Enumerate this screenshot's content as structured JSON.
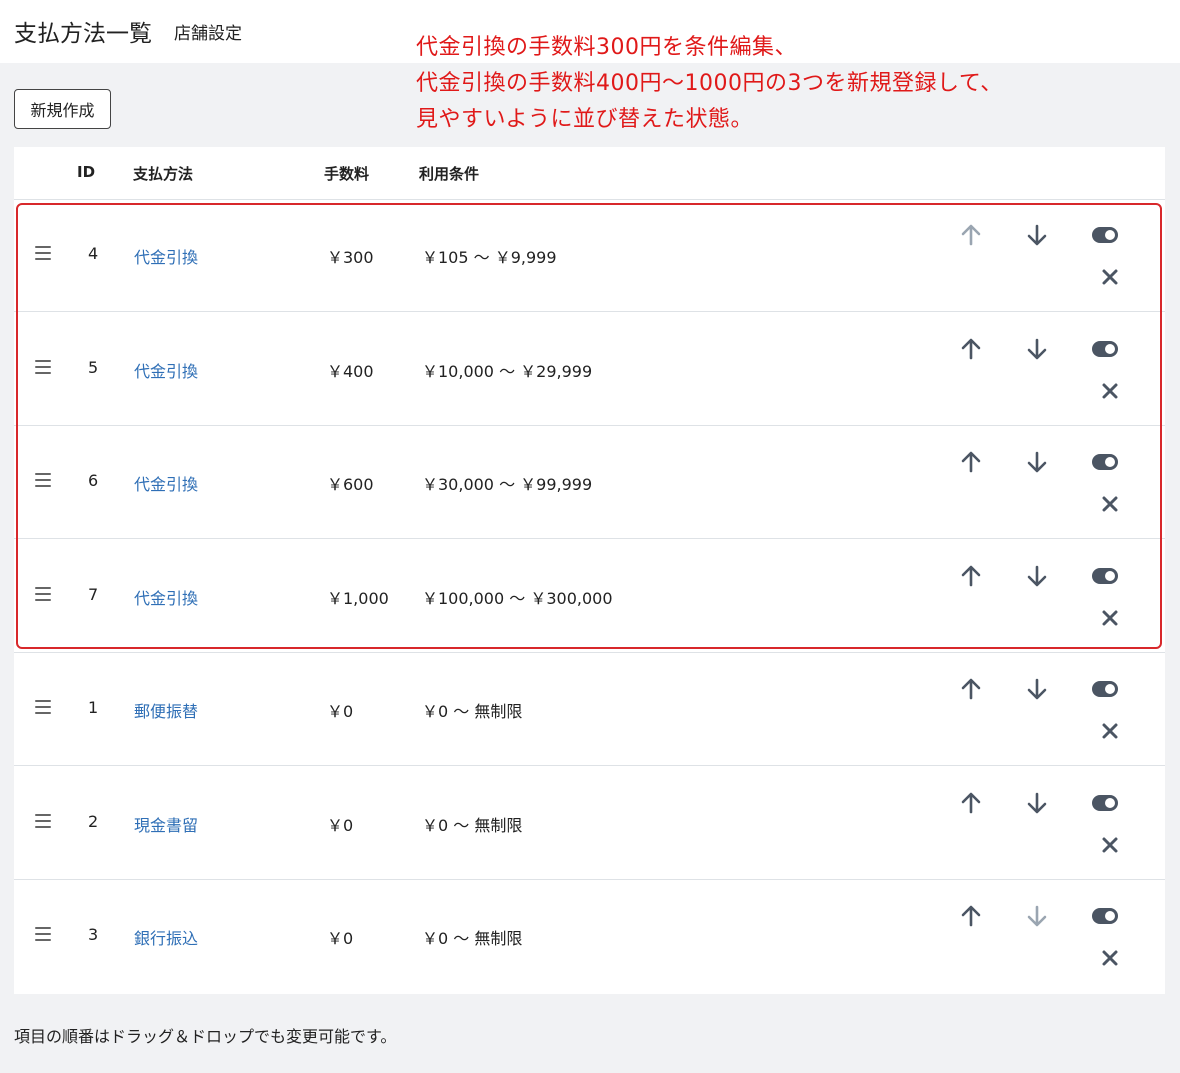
{
  "header": {
    "title": "支払方法一覧",
    "subtitle": "店舗設定"
  },
  "annotation": {
    "lines": [
      "代金引換の手数料300円を条件編集、",
      "代金引換の手数料400円〜1000円の3つを新規登録して、",
      "見やすいように並び替えた状態。"
    ],
    "color": "#e01919"
  },
  "toolbar": {
    "new_label": "新規作成"
  },
  "table": {
    "columns": {
      "id": "ID",
      "method": "支払方法",
      "fee": "手数料",
      "condition": "利用条件"
    },
    "rows": [
      {
        "id": "4",
        "method": "代金引換",
        "fee": "￥300",
        "condition": "￥105 〜 ￥9,999",
        "up_disabled": true,
        "down_disabled": false
      },
      {
        "id": "5",
        "method": "代金引換",
        "fee": "￥400",
        "condition": "￥10,000 〜 ￥29,999",
        "up_disabled": false,
        "down_disabled": false
      },
      {
        "id": "6",
        "method": "代金引換",
        "fee": "￥600",
        "condition": "￥30,000 〜 ￥99,999",
        "up_disabled": false,
        "down_disabled": false
      },
      {
        "id": "7",
        "method": "代金引換",
        "fee": "￥1,000",
        "condition": "￥100,000 〜 ￥300,000",
        "up_disabled": false,
        "down_disabled": false
      },
      {
        "id": "1",
        "method": "郵便振替",
        "fee": "￥0",
        "condition": "￥0 〜 無制限",
        "up_disabled": false,
        "down_disabled": false
      },
      {
        "id": "2",
        "method": "現金書留",
        "fee": "￥0",
        "condition": "￥0 〜 無制限",
        "up_disabled": false,
        "down_disabled": false
      },
      {
        "id": "3",
        "method": "銀行振込",
        "fee": "￥0",
        "condition": "￥0 〜 無制限",
        "up_disabled": false,
        "down_disabled": true
      }
    ]
  },
  "colors": {
    "link": "#2f6fb6",
    "icon": "#4b5563",
    "icon_disabled": "#9aa5b1",
    "highlight": "#d8282b"
  },
  "icons": {
    "drag": "drag-handle-icon",
    "up": "arrow-up-icon",
    "down": "arrow-down-icon",
    "toggle": "toggle-icon",
    "delete": "close-icon"
  },
  "footer": {
    "note": "項目の順番はドラッグ＆ドロップでも変更可能です。"
  }
}
